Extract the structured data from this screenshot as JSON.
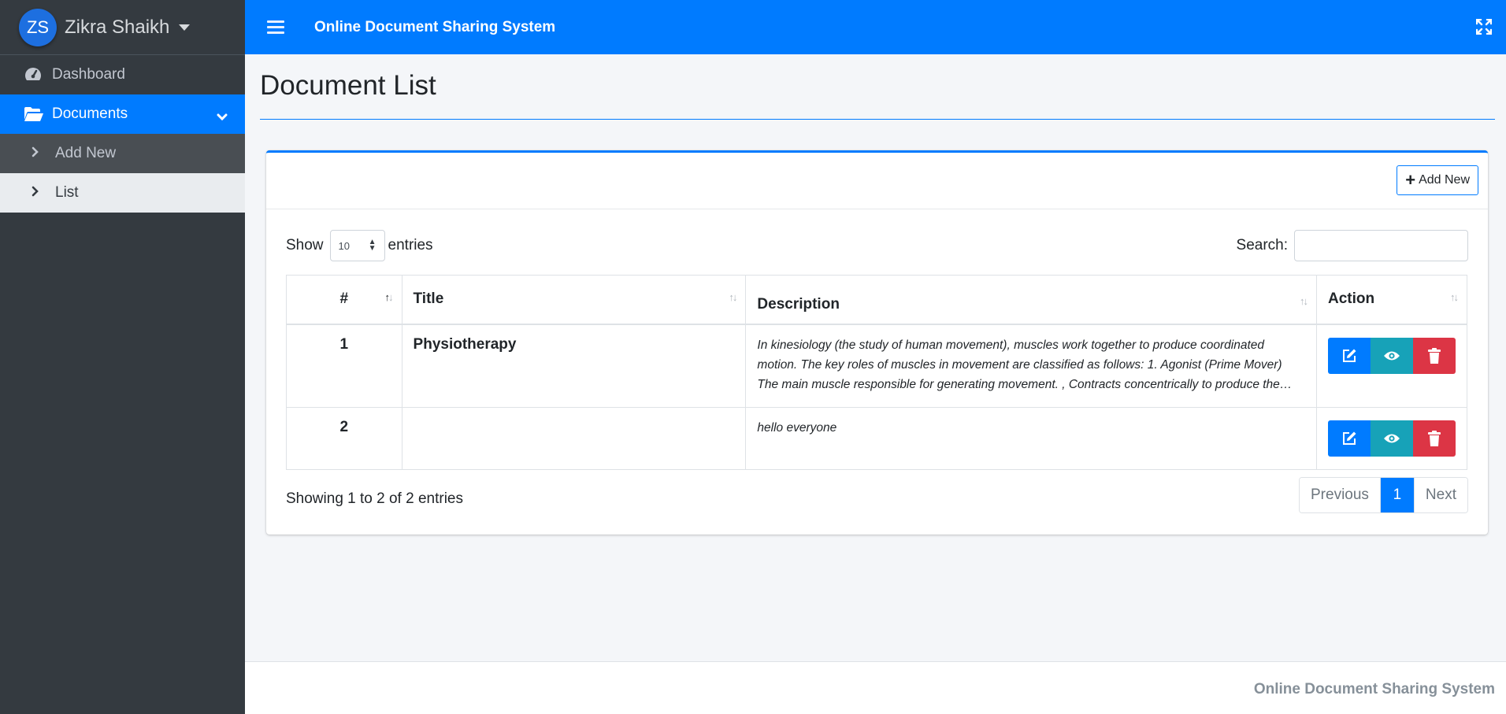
{
  "user": {
    "initials": "ZS",
    "name": "Zikra Shaikh"
  },
  "app_title": "Online Document Sharing System",
  "sidebar": {
    "items": [
      {
        "label": "Dashboard",
        "icon": "dashboard-gauge-icon"
      },
      {
        "label": "Documents",
        "icon": "folder-open-icon",
        "active": true
      },
      {
        "label": "Add New",
        "icon": "chevron-right-icon"
      },
      {
        "label": "List",
        "icon": "chevron-right-icon",
        "selected": true
      }
    ]
  },
  "page": {
    "title": "Document List"
  },
  "card": {
    "add_new_label": "Add New",
    "length": {
      "show": "Show",
      "value": "10",
      "entries": "entries"
    },
    "search": {
      "label": "Search:",
      "value": "",
      "placeholder": ""
    },
    "columns": [
      "#",
      "Title",
      "Description",
      "Action"
    ],
    "rows": [
      {
        "num": "1",
        "title": "Physiotherapy",
        "description": "In kinesiology (the study of human movement), muscles work together to produce coordinated motion. The key roles of muscles in movement are classified as follows: 1. Agonist (Prime Mover) The main muscle responsible for generating movement. , Contracts concentrically to produce the desired action."
      },
      {
        "num": "2",
        "title": "",
        "description": "hello everyone"
      }
    ],
    "info": "Showing 1 to 2 of 2 entries",
    "pagination": {
      "previous": "Previous",
      "current": "1",
      "next": "Next"
    }
  },
  "footer": {
    "text": "Online Document Sharing System"
  },
  "colors": {
    "primary": "#007bff",
    "info": "#17a2b8",
    "danger": "#dc3545",
    "sidebar_bg": "#343a40",
    "content_bg": "#f4f6f9"
  }
}
